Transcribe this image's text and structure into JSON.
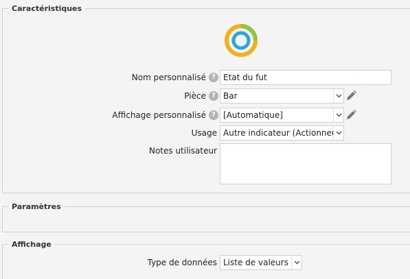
{
  "sections": {
    "caracteristiques": "Caractéristiques",
    "parametres": "Paramètres",
    "affichage": "Affichage"
  },
  "form": {
    "nom": {
      "label": "Nom personnalisé",
      "value": "Etat du fut"
    },
    "piece": {
      "label": "Pièce",
      "value": "Bar"
    },
    "affichage_perso": {
      "label": "Affichage personnalisé",
      "value": "[Automatique]"
    },
    "usage": {
      "label": "Usage",
      "value": "Autre indicateur (Actionneur)"
    },
    "notes": {
      "label": "Notes utilisateur",
      "value": ""
    }
  },
  "display": {
    "type_donnees": {
      "label": "Type de données",
      "value": "Liste de valeurs"
    }
  },
  "icons": {
    "help": "help-icon",
    "edit": "pencil-icon",
    "dropdown": "chevron-down-icon",
    "logo": "ring-logo-icon"
  },
  "colors": {
    "logo_outer_yellow": "#f2b01e",
    "logo_outer_green": "#8fc43f",
    "logo_inner_blue": "#2aa6d8",
    "edit_icon": "#6a7a8c",
    "help_badge": "#b3b3b3"
  }
}
